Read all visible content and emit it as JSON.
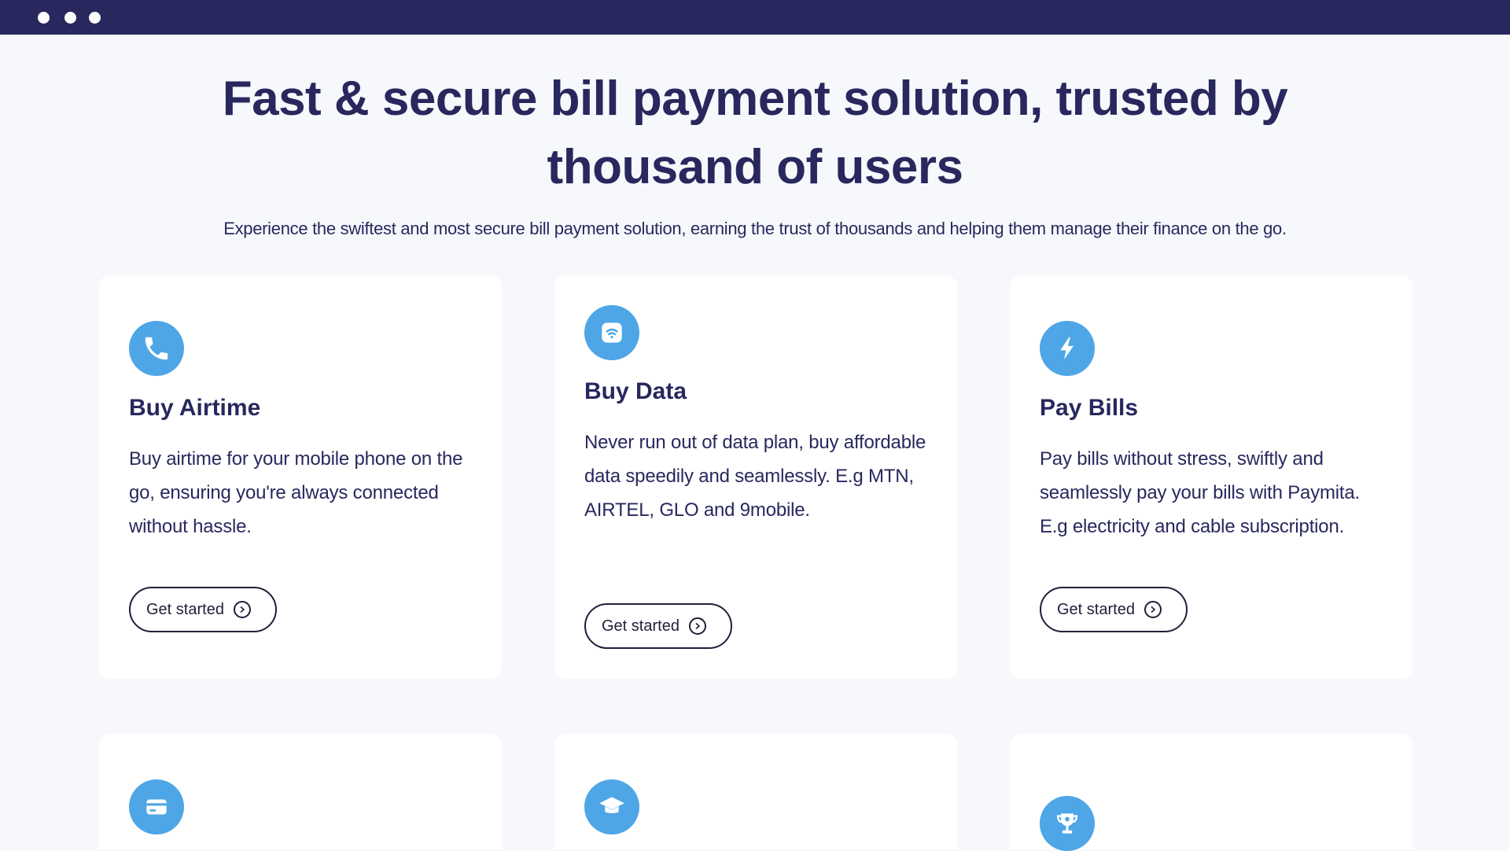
{
  "hero": {
    "title": "Fast & secure bill payment solution, trusted by thousand of users",
    "subtitle": "Experience the swiftest and most secure bill payment solution, earning the trust of thousands and helping them manage their finance on the go."
  },
  "cards": [
    {
      "title": "Buy Airtime",
      "description": "Buy airtime for your mobile phone on the go, ensuring you're always connected without hassle.",
      "button": "Get started",
      "icon": "phone-icon"
    },
    {
      "title": "Buy Data",
      "description": "Never run out of data plan, buy affordable data speedily and seamlessly. E.g MTN, AIRTEL, GLO and 9mobile.",
      "button": "Get started",
      "icon": "wifi-icon"
    },
    {
      "title": "Pay Bills",
      "description": "Pay bills without stress, swiftly and seamlessly pay your bills with Paymita. E.g electricity and cable subscription.",
      "button": "Get started",
      "icon": "lightning-icon"
    },
    {
      "icon": "credit-card-icon"
    },
    {
      "icon": "graduation-cap-icon"
    },
    {
      "icon": "trophy-icon"
    }
  ],
  "colors": {
    "navy": "#28285e",
    "accent_blue": "#4ea6e6",
    "background": "#f7f8fb",
    "card": "#ffffff"
  }
}
